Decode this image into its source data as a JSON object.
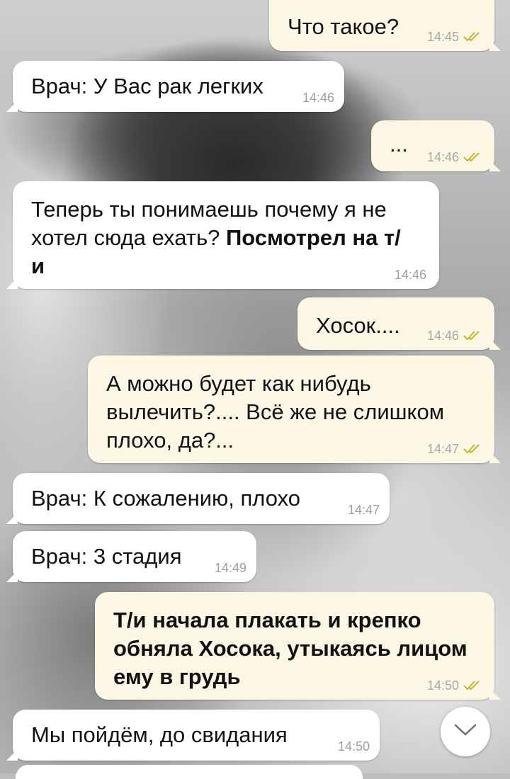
{
  "messages": [
    {
      "id": "m1",
      "dir": "out",
      "text": "Что такое?",
      "bold": "",
      "time": "14:45",
      "read": true
    },
    {
      "id": "m2",
      "dir": "in",
      "text": "Врач: У Вас рак легких",
      "bold": "",
      "time": "14:46"
    },
    {
      "id": "m3",
      "dir": "out",
      "text": "...",
      "bold": "",
      "time": "14:46",
      "read": true
    },
    {
      "id": "m4",
      "dir": "in",
      "text": "Теперь ты понимаешь почему я не хотел сюда ехать? ",
      "bold": "Посмотрел на т/и",
      "time": "14:46"
    },
    {
      "id": "m5",
      "dir": "out",
      "text": "Хосок....",
      "bold": "",
      "time": "14:46",
      "read": true
    },
    {
      "id": "m6",
      "dir": "out",
      "text": "А можно будет как нибудь вылечить?.... Всё же не слишком плохо, да?...",
      "bold": "",
      "time": "14:47",
      "read": true
    },
    {
      "id": "m7",
      "dir": "in",
      "text": "Врач: К сожалению, плохо",
      "bold": "",
      "time": "14:47"
    },
    {
      "id": "m8",
      "dir": "in",
      "text": "Врач: 3 стадия",
      "bold": "",
      "time": "14:49"
    },
    {
      "id": "m9",
      "dir": "out",
      "text": "",
      "bold": "Т/и начала плакать и крепко обняла Хосока, утыкаясь лицом ему в грудь",
      "time": "14:50",
      "read": true
    },
    {
      "id": "m10",
      "dir": "in",
      "text": "Мы пойдём, до свидания",
      "bold": "",
      "time": "14:50"
    }
  ],
  "scroll_button": {
    "icon": "chevron-down-icon"
  },
  "colors": {
    "incoming": "#ffffff",
    "outgoing": "#fbf7e4",
    "check": "#c9b23a",
    "time": "#a8a8a8"
  }
}
